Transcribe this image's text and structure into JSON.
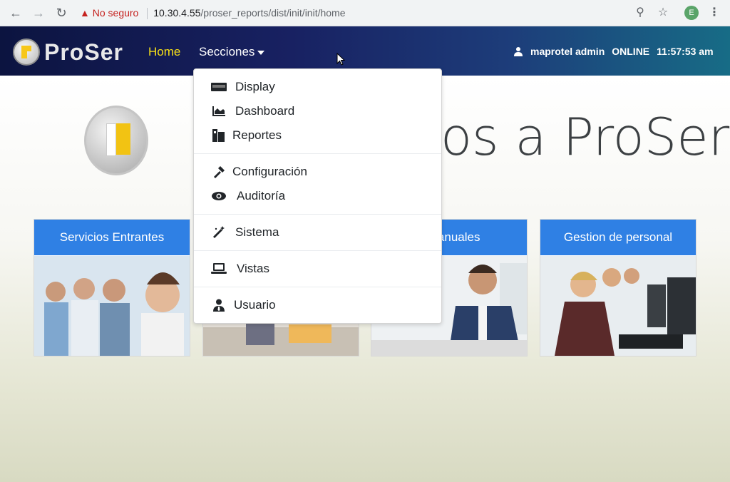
{
  "browser": {
    "security_label": "No seguro",
    "url_host": "10.30.4.55",
    "url_path": "/proser_reports/dist/init/init/home",
    "profile_initial": "E"
  },
  "navbar": {
    "brand": "ProSer",
    "home": "Home",
    "secciones": "Secciones",
    "user": "maprotel admin",
    "status": "ONLINE",
    "time": "11:57:53 am"
  },
  "page": {
    "welcome_visible": "os a ProSer"
  },
  "cards": [
    {
      "title": "Servicios Entrantes"
    },
    {
      "title": ""
    },
    {
      "title": "s Manuales"
    },
    {
      "title": "Gestion de personal"
    }
  ],
  "dropdown": {
    "items": [
      {
        "label": "Display",
        "icon": "display-icon"
      },
      {
        "label": "Dashboard",
        "icon": "chart-area-icon"
      },
      {
        "label": "Reportes",
        "icon": "reports-icon"
      },
      {
        "label": "Configuración",
        "icon": "wrench-icon"
      },
      {
        "label": "Auditoría",
        "icon": "eye-icon"
      },
      {
        "label": "Sistema",
        "icon": "magic-wand-icon"
      },
      {
        "label": "Vistas",
        "icon": "laptop-icon"
      },
      {
        "label": "Usuario",
        "icon": "user-tie-icon"
      }
    ]
  },
  "colors": {
    "navbar_start": "#0c1440",
    "navbar_end": "#176c86",
    "home_active": "#f7e017",
    "card_header": "#2f80e4"
  }
}
